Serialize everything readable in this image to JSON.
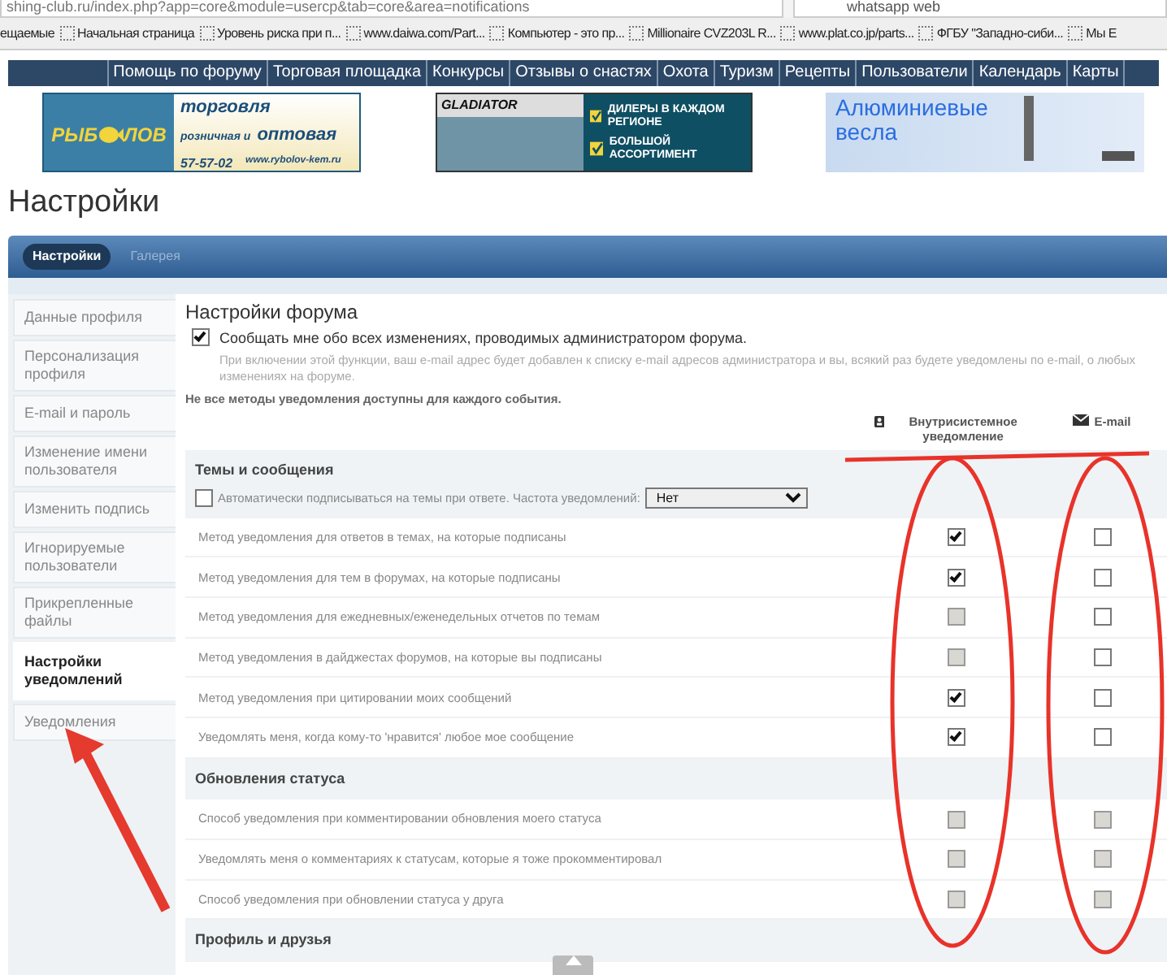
{
  "browser": {
    "url": "shing-club.ru/index.php?app=core&module=usercp&tab=core&area=notifications",
    "search": "whatsapp web",
    "bookmarks": [
      {
        "label": "ещаемые",
        "icon": false
      },
      {
        "label": "Начальная страница",
        "icon": true
      },
      {
        "label": "Уровень риска при п...",
        "icon": true
      },
      {
        "label": "www.daiwa.com/Part...",
        "icon": true
      },
      {
        "label": "Компьютер - это пр...",
        "icon": true
      },
      {
        "label": "Millionaire CVZ203L R...",
        "icon": true
      },
      {
        "label": "www.plat.co.jp/parts...",
        "icon": true
      },
      {
        "label": "ФГБУ \"Западно-сиби...",
        "icon": true
      },
      {
        "label": "Мы Е",
        "icon": true
      }
    ]
  },
  "nav": [
    "Помощь по форуму",
    "Торговая площадка",
    "Конкурсы",
    "Отзывы о снастях",
    "Охота",
    "Туризм",
    "Рецепты",
    "Пользователи",
    "Календарь",
    "Карты"
  ],
  "banners": [
    {
      "kind": "shop",
      "logo_left": "РЫБ",
      "logo_right": "ЛОВ",
      "line_1": "торговля",
      "line_2_small": "розничная и",
      "line_2_big": "оптовая",
      "phone": "57-57-02",
      "site": "www.rybolov-kem.ru"
    },
    {
      "kind": "boats",
      "logo": "GLADIATOR",
      "points": [
        "ДИЛЕРЫ В КАЖДОМ РЕГИОНЕ",
        "БОЛЬШОЙ АССОРТИМЕНТ"
      ]
    },
    {
      "kind": "oars",
      "text": "Алюминиевые весла"
    }
  ],
  "page_title": "Настройки",
  "tabs": [
    {
      "label": "Настройки",
      "selected": true
    },
    {
      "label": "Галерея",
      "selected": false
    }
  ],
  "sidebar": {
    "items": [
      {
        "label": "Данные профиля",
        "selected": false
      },
      {
        "label": "Персонализация профиля",
        "selected": false
      },
      {
        "label": "E-mail и пароль",
        "selected": false
      },
      {
        "label": "Изменение имени пользователя",
        "selected": false
      },
      {
        "label": "Изменить подпись",
        "selected": false
      },
      {
        "label": "Игнорируемые пользователи",
        "selected": false
      },
      {
        "label": "Прикрепленные файлы",
        "selected": false
      },
      {
        "label": "Настройки уведомлений",
        "selected": true
      },
      {
        "label": "Уведомления",
        "selected": false
      }
    ]
  },
  "content": {
    "title": "Настройки форума",
    "admin_notice": {
      "label": "Сообщать мне обо всех изменениях, проводимых администратором форума.",
      "checked": true,
      "hint": "При включении этой функции, ваш e-mail адрес будет добавлен к списку e-mail адресов администратора и вы, всякий раз будете уведомлены по e-mail, о любых изменениях на форуме."
    },
    "note": "Не все методы уведомления доступны для каждого события.",
    "columns": [
      {
        "kind": "inline",
        "label": "Внутрисистемное уведомление"
      },
      {
        "kind": "email",
        "label": "E-mail"
      }
    ],
    "sections": [
      {
        "title": "Темы и сообщения",
        "auto_subscribe": {
          "label": "Автоматически подписываться на темы при ответе. Частота уведомлений:",
          "checked": false,
          "value": "Нет"
        },
        "rows": [
          {
            "label": "Метод уведомления для ответов в темах, на которые подписаны",
            "inline": {
              "checked": true,
              "disabled": false
            },
            "email": {
              "checked": false,
              "disabled": false
            }
          },
          {
            "label": "Метод уведомления для тем в форумах, на которые подписаны",
            "inline": {
              "checked": true,
              "disabled": false
            },
            "email": {
              "checked": false,
              "disabled": false
            }
          },
          {
            "label": "Метод уведомления для ежедневных/еженедельных отчетов по темам",
            "inline": {
              "checked": false,
              "disabled": true
            },
            "email": {
              "checked": false,
              "disabled": false
            }
          },
          {
            "label": "Метод уведомления в дайджестах форумов, на которые вы подписаны",
            "inline": {
              "checked": false,
              "disabled": true
            },
            "email": {
              "checked": false,
              "disabled": false
            }
          },
          {
            "label": "Метод уведомления при цитировании моих сообщений",
            "inline": {
              "checked": true,
              "disabled": false
            },
            "email": {
              "checked": false,
              "disabled": false
            }
          },
          {
            "label": "Уведомлять меня, когда кому-то 'нравится' любое мое сообщение",
            "inline": {
              "checked": true,
              "disabled": false
            },
            "email": {
              "checked": false,
              "disabled": false
            }
          }
        ]
      },
      {
        "title": "Обновления статуса",
        "rows": [
          {
            "label": "Способ уведомления при комментировании обновления моего статуса",
            "inline": {
              "checked": false,
              "disabled": true
            },
            "email": {
              "checked": false,
              "disabled": true
            }
          },
          {
            "label": "Уведомлять меня о комментариях к статусам, которые я тоже прокомментировал",
            "inline": {
              "checked": false,
              "disabled": true
            },
            "email": {
              "checked": false,
              "disabled": true
            }
          },
          {
            "label": "Способ уведомления при обновлении статуса у друга",
            "inline": {
              "checked": false,
              "disabled": true
            },
            "email": {
              "checked": false,
              "disabled": true
            }
          }
        ]
      },
      {
        "title": "Профиль и друзья"
      }
    ]
  }
}
